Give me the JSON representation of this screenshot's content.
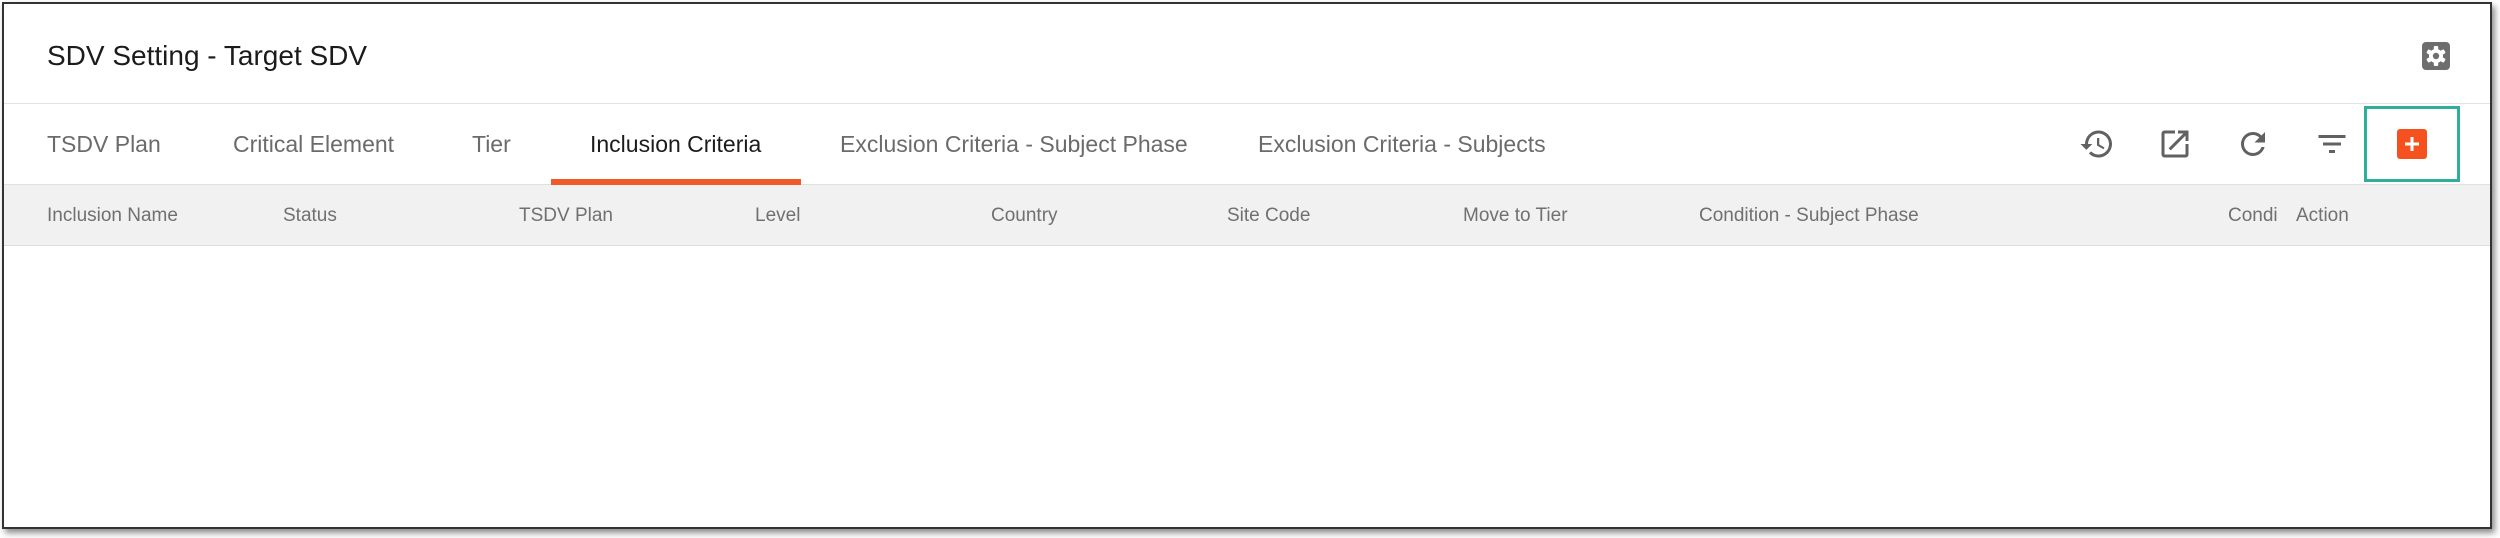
{
  "header": {
    "title": "SDV Setting - Target SDV",
    "settings_icon": "gear-icon"
  },
  "tabs": [
    {
      "label": "TSDV Plan",
      "active": false
    },
    {
      "label": "Critical Element",
      "active": false
    },
    {
      "label": "Tier",
      "active": false
    },
    {
      "label": "Inclusion Criteria",
      "active": true
    },
    {
      "label": "Exclusion Criteria - Subject Phase",
      "active": false
    },
    {
      "label": "Exclusion Criteria - Subjects",
      "active": false
    }
  ],
  "toolbar": {
    "icons": [
      "history-icon",
      "open-external-icon",
      "refresh-icon",
      "filter-icon",
      "add-icon"
    ],
    "accent_color": "#f4511e",
    "highlight_color": "#2fae9b"
  },
  "table": {
    "columns": [
      "Inclusion Name",
      "Status",
      "TSDV Plan",
      "Level",
      "Country",
      "Site Code",
      "Move to Tier",
      "Condition - Subject Phase",
      "Condi",
      "Action"
    ],
    "rows": []
  }
}
